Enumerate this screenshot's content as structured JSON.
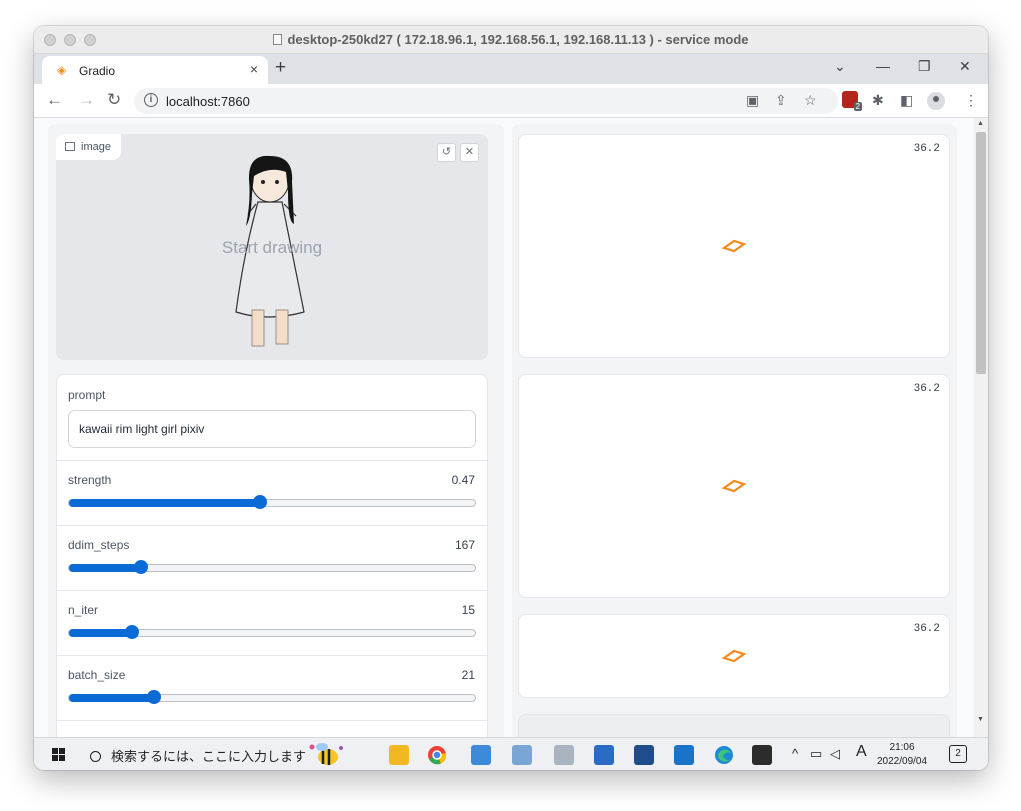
{
  "window": {
    "title": "desktop-250kd27 ( 172.18.96.1, 192.168.56.1, 192.168.11.13 ) - service mode"
  },
  "browser": {
    "tab_title": "Gradio",
    "new_tab": "+",
    "url": "localhost:7860",
    "tab_close": "×"
  },
  "image_input": {
    "label": "image",
    "placeholder": "Start drawing"
  },
  "controls": {
    "prompt_label": "prompt",
    "prompt_value": "kawaii rim light girl pixiv",
    "sliders": [
      {
        "label": "strength",
        "value": "0.47",
        "fraction": 0.47
      },
      {
        "label": "ddim_steps",
        "value": "167",
        "fraction": 0.177
      },
      {
        "label": "n_iter",
        "value": "15",
        "fraction": 0.155
      },
      {
        "label": "batch_size",
        "value": "21",
        "fraction": 0.21
      }
    ]
  },
  "outputs": {
    "timers": [
      "36.2",
      "36.2",
      "36.2"
    ],
    "loader_color": "#f58a1f"
  },
  "taskbar": {
    "search_placeholder": "検索するには、ここに入力します",
    "ime_indicator": "A",
    "time": "21:06",
    "date": "2022/09/04",
    "notification_count": "2"
  },
  "colors": {
    "accent": "#0b6bd6",
    "page_bg": "#f9fafb"
  }
}
